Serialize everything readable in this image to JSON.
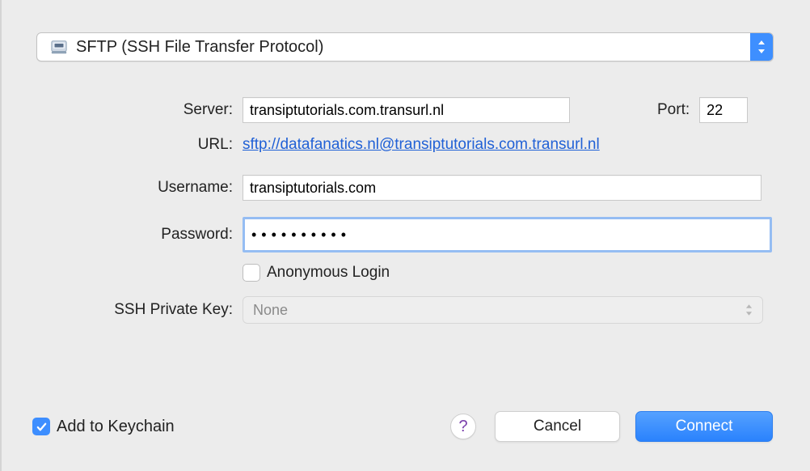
{
  "protocol": {
    "label": "SFTP (SSH File Transfer Protocol)"
  },
  "labels": {
    "server": "Server:",
    "port": "Port:",
    "url": "URL:",
    "username": "Username:",
    "password": "Password:",
    "anonymous": "Anonymous Login",
    "sshkey": "SSH Private Key:",
    "keychain": "Add to Keychain",
    "help": "?",
    "cancel": "Cancel",
    "connect": "Connect"
  },
  "values": {
    "server": "transiptutorials.com.transurl.nl",
    "port": "22",
    "url": "sftp://datafanatics.nl@transiptutorials.com.transurl.nl",
    "username": "transiptutorials.com",
    "password": "••••••••••",
    "sshkey": "None"
  }
}
